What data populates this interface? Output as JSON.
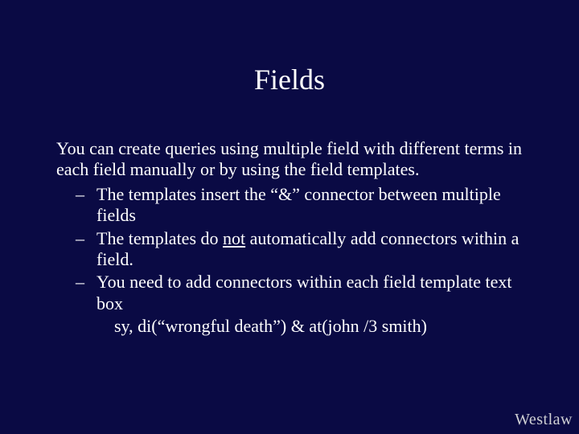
{
  "title": "Fields",
  "intro": "You can create queries using multiple field with different terms in each field manually or by using the field templates.",
  "bullets": [
    {
      "prefix": "The templates insert the “",
      "amp": "&",
      "suffix": "” connector between multiple fields"
    },
    {
      "prefix": "The templates do ",
      "underlined": "not",
      "suffix": " automatically add connectors within a field."
    },
    {
      "text": "You need to add connectors within each field template text box"
    }
  ],
  "example": "sy, di(“wrongful death”) & at(john  /3 smith)",
  "logo": {
    "west": "West",
    "law": "law"
  }
}
